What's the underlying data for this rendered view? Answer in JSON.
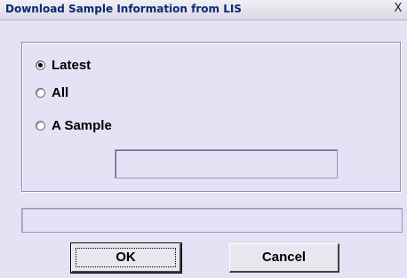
{
  "window": {
    "title": "Download Sample Information from LIS",
    "close_label": "X"
  },
  "options": {
    "latest_label": "Latest",
    "all_label": "All",
    "sample_label": "A Sample",
    "selected": "Latest"
  },
  "sample_input": {
    "value": "",
    "placeholder": ""
  },
  "status": {
    "text": ""
  },
  "buttons": {
    "ok_label": "OK",
    "cancel_label": "Cancel"
  },
  "icons": {
    "close": "close-icon",
    "radio": "radio-button-icon"
  },
  "colors": {
    "dialog_bg": "#e4e2f4",
    "title_text": "#0a2a74"
  }
}
